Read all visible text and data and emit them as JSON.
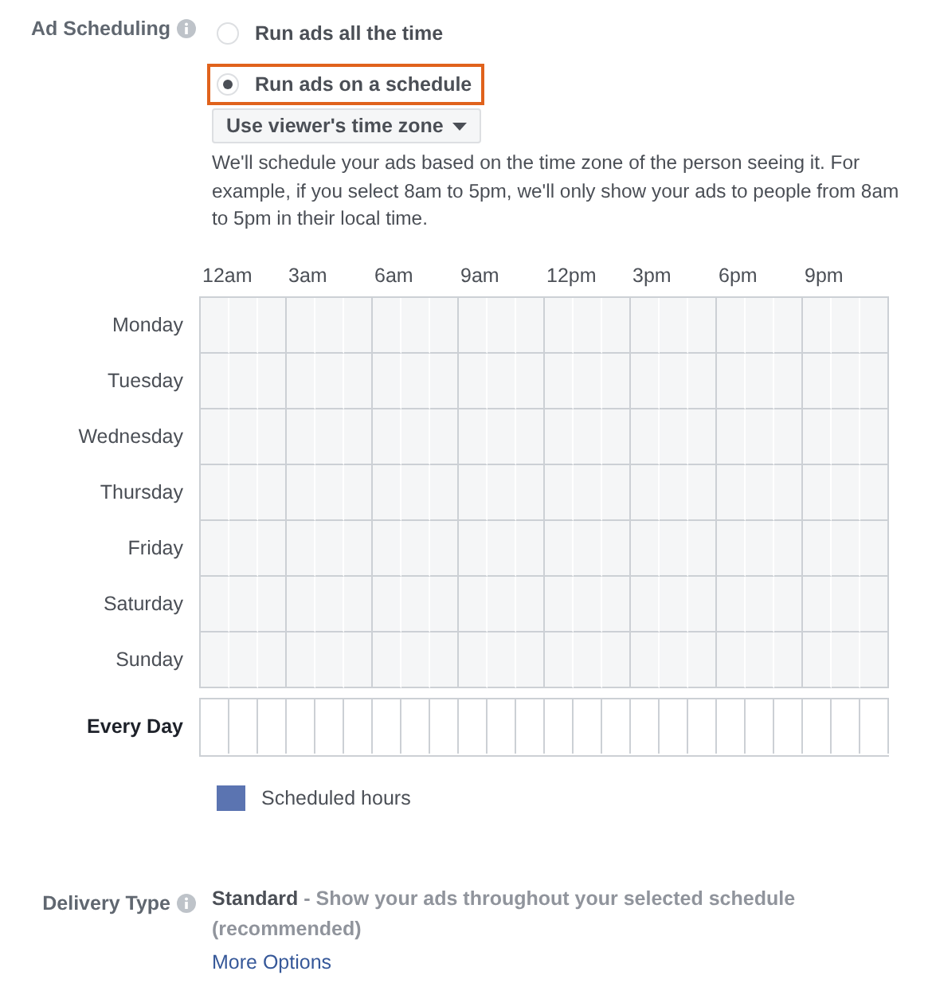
{
  "ad_scheduling": {
    "label": "Ad Scheduling",
    "options": [
      {
        "label": "Run ads all the time",
        "selected": false
      },
      {
        "label": "Run ads on a schedule",
        "selected": true
      }
    ],
    "timezone_dropdown": "Use viewer's time zone",
    "help_text": "We'll schedule your ads based on the time zone of the person seeing it. For example, if you select 8am to 5pm, we'll only show your ads to people from 8am to 5pm in their local time.",
    "hour_labels": [
      "12am",
      "3am",
      "6am",
      "9am",
      "12pm",
      "3pm",
      "6pm",
      "9pm"
    ],
    "days": [
      "Monday",
      "Tuesday",
      "Wednesday",
      "Thursday",
      "Friday",
      "Saturday",
      "Sunday"
    ],
    "every_day_label": "Every Day",
    "legend": "Scheduled hours"
  },
  "delivery_type": {
    "label": "Delivery Type",
    "name": "Standard",
    "description": "- Show your ads throughout your selected schedule (recommended)",
    "link": "More Options"
  }
}
